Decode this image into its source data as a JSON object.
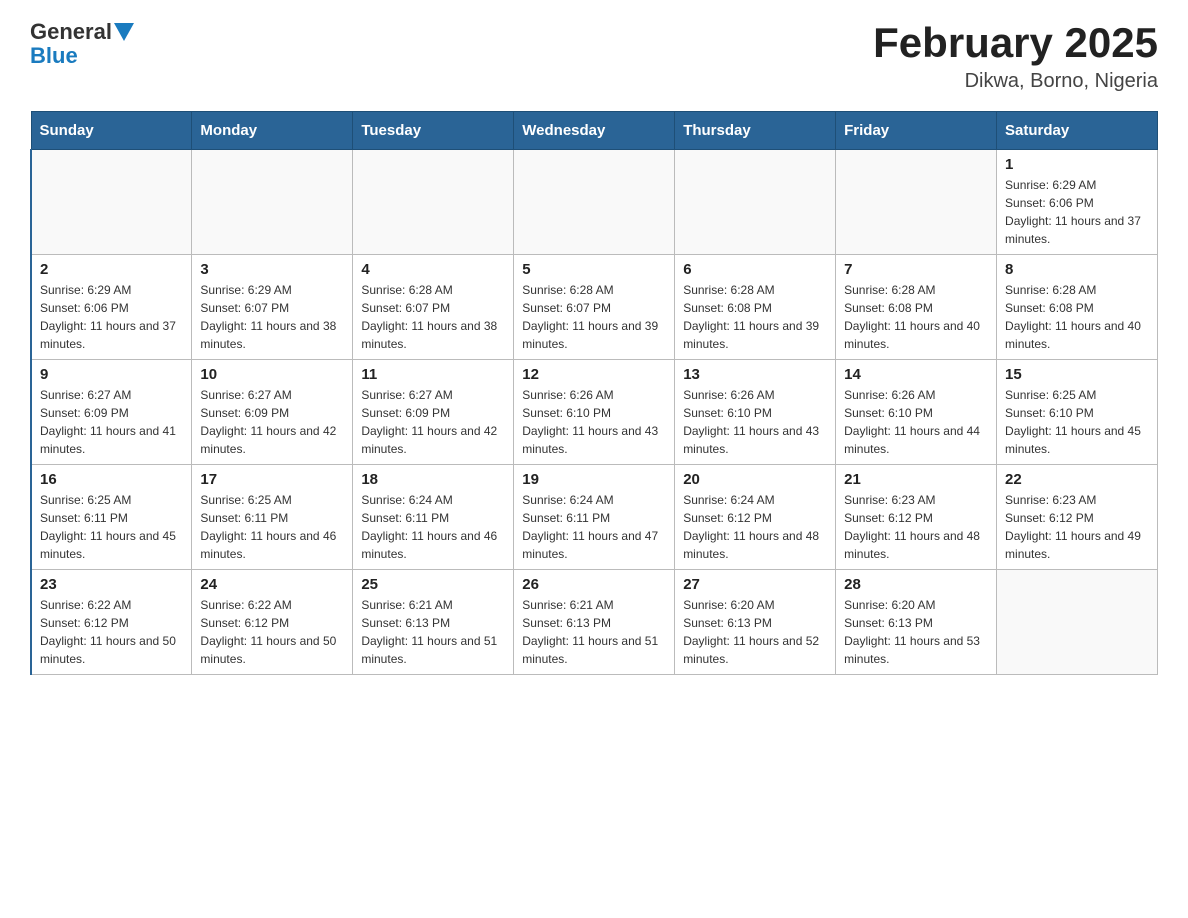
{
  "header": {
    "logo_general": "General",
    "logo_blue": "Blue",
    "title": "February 2025",
    "subtitle": "Dikwa, Borno, Nigeria"
  },
  "calendar": {
    "days_of_week": [
      "Sunday",
      "Monday",
      "Tuesday",
      "Wednesday",
      "Thursday",
      "Friday",
      "Saturday"
    ],
    "weeks": [
      [
        {
          "day": "",
          "info": ""
        },
        {
          "day": "",
          "info": ""
        },
        {
          "day": "",
          "info": ""
        },
        {
          "day": "",
          "info": ""
        },
        {
          "day": "",
          "info": ""
        },
        {
          "day": "",
          "info": ""
        },
        {
          "day": "1",
          "info": "Sunrise: 6:29 AM\nSunset: 6:06 PM\nDaylight: 11 hours and 37 minutes."
        }
      ],
      [
        {
          "day": "2",
          "info": "Sunrise: 6:29 AM\nSunset: 6:06 PM\nDaylight: 11 hours and 37 minutes."
        },
        {
          "day": "3",
          "info": "Sunrise: 6:29 AM\nSunset: 6:07 PM\nDaylight: 11 hours and 38 minutes."
        },
        {
          "day": "4",
          "info": "Sunrise: 6:28 AM\nSunset: 6:07 PM\nDaylight: 11 hours and 38 minutes."
        },
        {
          "day": "5",
          "info": "Sunrise: 6:28 AM\nSunset: 6:07 PM\nDaylight: 11 hours and 39 minutes."
        },
        {
          "day": "6",
          "info": "Sunrise: 6:28 AM\nSunset: 6:08 PM\nDaylight: 11 hours and 39 minutes."
        },
        {
          "day": "7",
          "info": "Sunrise: 6:28 AM\nSunset: 6:08 PM\nDaylight: 11 hours and 40 minutes."
        },
        {
          "day": "8",
          "info": "Sunrise: 6:28 AM\nSunset: 6:08 PM\nDaylight: 11 hours and 40 minutes."
        }
      ],
      [
        {
          "day": "9",
          "info": "Sunrise: 6:27 AM\nSunset: 6:09 PM\nDaylight: 11 hours and 41 minutes."
        },
        {
          "day": "10",
          "info": "Sunrise: 6:27 AM\nSunset: 6:09 PM\nDaylight: 11 hours and 42 minutes."
        },
        {
          "day": "11",
          "info": "Sunrise: 6:27 AM\nSunset: 6:09 PM\nDaylight: 11 hours and 42 minutes."
        },
        {
          "day": "12",
          "info": "Sunrise: 6:26 AM\nSunset: 6:10 PM\nDaylight: 11 hours and 43 minutes."
        },
        {
          "day": "13",
          "info": "Sunrise: 6:26 AM\nSunset: 6:10 PM\nDaylight: 11 hours and 43 minutes."
        },
        {
          "day": "14",
          "info": "Sunrise: 6:26 AM\nSunset: 6:10 PM\nDaylight: 11 hours and 44 minutes."
        },
        {
          "day": "15",
          "info": "Sunrise: 6:25 AM\nSunset: 6:10 PM\nDaylight: 11 hours and 45 minutes."
        }
      ],
      [
        {
          "day": "16",
          "info": "Sunrise: 6:25 AM\nSunset: 6:11 PM\nDaylight: 11 hours and 45 minutes."
        },
        {
          "day": "17",
          "info": "Sunrise: 6:25 AM\nSunset: 6:11 PM\nDaylight: 11 hours and 46 minutes."
        },
        {
          "day": "18",
          "info": "Sunrise: 6:24 AM\nSunset: 6:11 PM\nDaylight: 11 hours and 46 minutes."
        },
        {
          "day": "19",
          "info": "Sunrise: 6:24 AM\nSunset: 6:11 PM\nDaylight: 11 hours and 47 minutes."
        },
        {
          "day": "20",
          "info": "Sunrise: 6:24 AM\nSunset: 6:12 PM\nDaylight: 11 hours and 48 minutes."
        },
        {
          "day": "21",
          "info": "Sunrise: 6:23 AM\nSunset: 6:12 PM\nDaylight: 11 hours and 48 minutes."
        },
        {
          "day": "22",
          "info": "Sunrise: 6:23 AM\nSunset: 6:12 PM\nDaylight: 11 hours and 49 minutes."
        }
      ],
      [
        {
          "day": "23",
          "info": "Sunrise: 6:22 AM\nSunset: 6:12 PM\nDaylight: 11 hours and 50 minutes."
        },
        {
          "day": "24",
          "info": "Sunrise: 6:22 AM\nSunset: 6:12 PM\nDaylight: 11 hours and 50 minutes."
        },
        {
          "day": "25",
          "info": "Sunrise: 6:21 AM\nSunset: 6:13 PM\nDaylight: 11 hours and 51 minutes."
        },
        {
          "day": "26",
          "info": "Sunrise: 6:21 AM\nSunset: 6:13 PM\nDaylight: 11 hours and 51 minutes."
        },
        {
          "day": "27",
          "info": "Sunrise: 6:20 AM\nSunset: 6:13 PM\nDaylight: 11 hours and 52 minutes."
        },
        {
          "day": "28",
          "info": "Sunrise: 6:20 AM\nSunset: 6:13 PM\nDaylight: 11 hours and 53 minutes."
        },
        {
          "day": "",
          "info": ""
        }
      ]
    ]
  }
}
